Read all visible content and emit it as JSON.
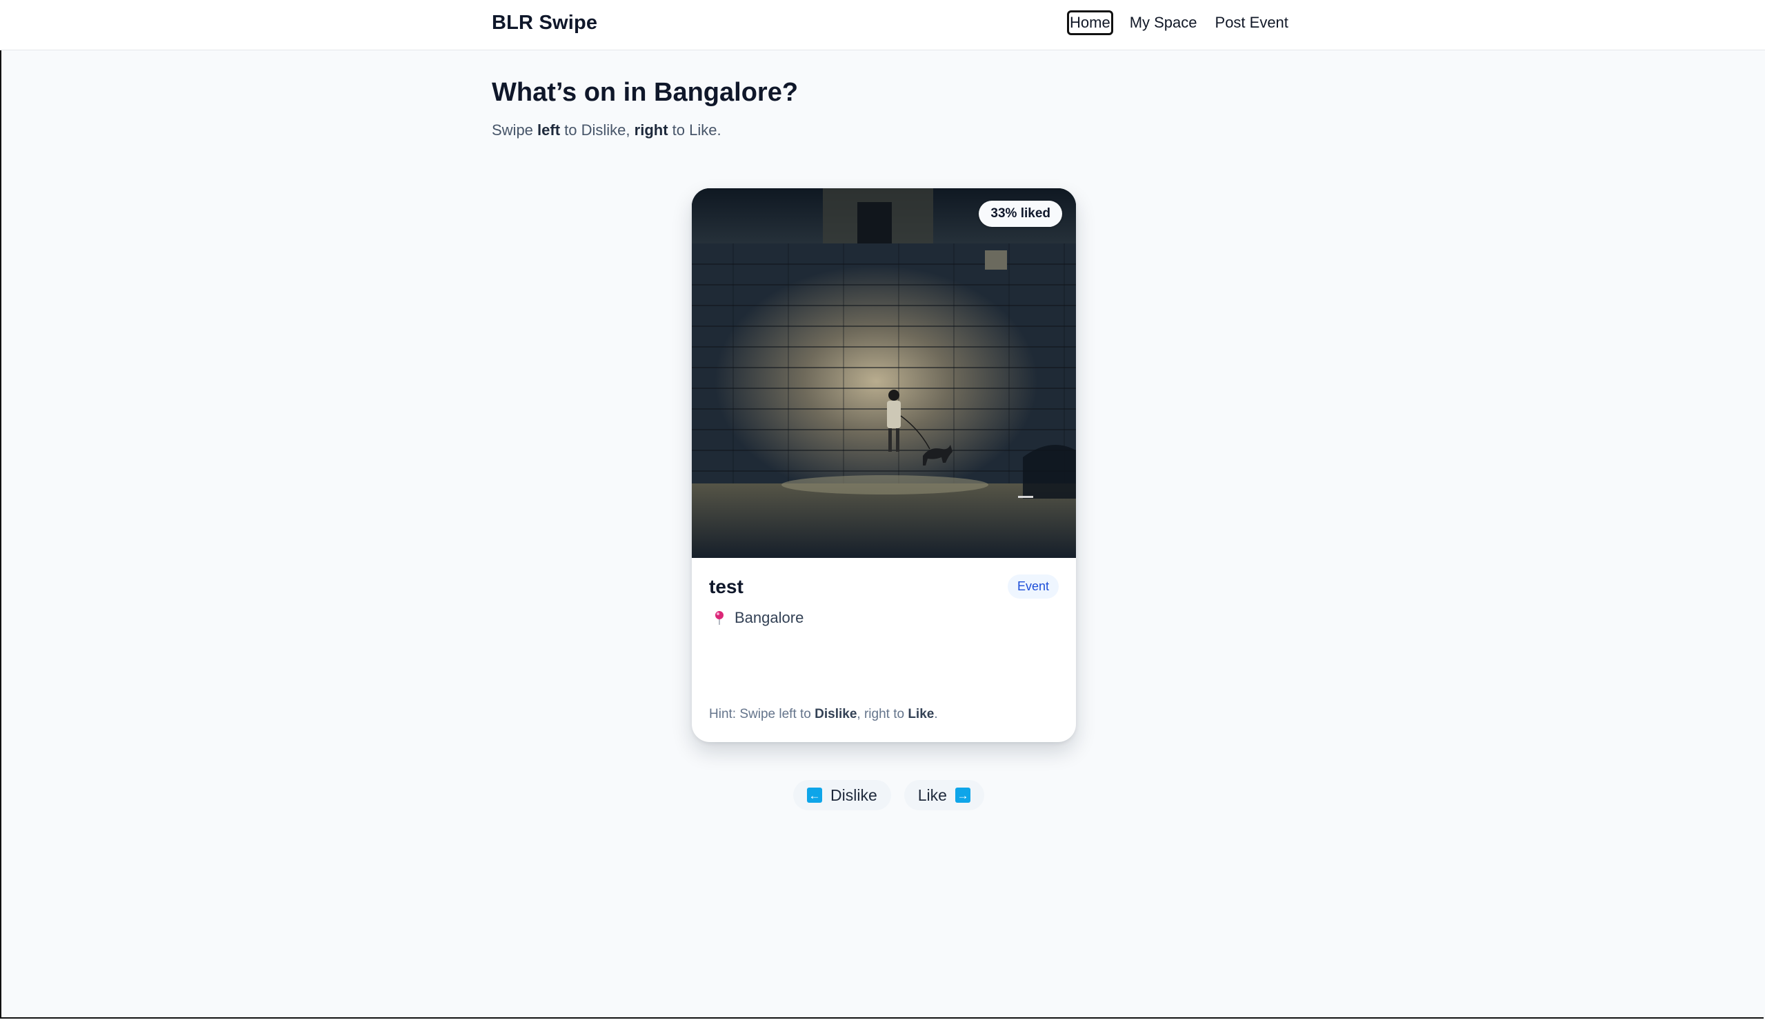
{
  "header": {
    "brand": "BLR Swipe",
    "nav": [
      {
        "label": "Home",
        "active": true
      },
      {
        "label": "My Space",
        "active": false
      },
      {
        "label": "Post Event",
        "active": false
      }
    ]
  },
  "main": {
    "title": "What’s on in Bangalore?",
    "subtitle": {
      "part1": "Swipe ",
      "bold1": "left",
      "part2": " to Dislike, ",
      "bold2": "right",
      "part3": " to Like."
    }
  },
  "card": {
    "liked_badge": "33% liked",
    "title": "test",
    "type": "Event",
    "location": "Bangalore",
    "location_icon": "pin-icon",
    "hint": {
      "part1": "Hint: Swipe left to ",
      "bold1": "Dislike",
      "part2": ", right to ",
      "bold2": "Like",
      "part3": "."
    }
  },
  "actions": {
    "dislike_label": "Dislike",
    "dislike_icon": "arrow-left-icon",
    "like_label": "Like",
    "like_icon": "arrow-right-icon",
    "accent": "#0ea5e9"
  }
}
